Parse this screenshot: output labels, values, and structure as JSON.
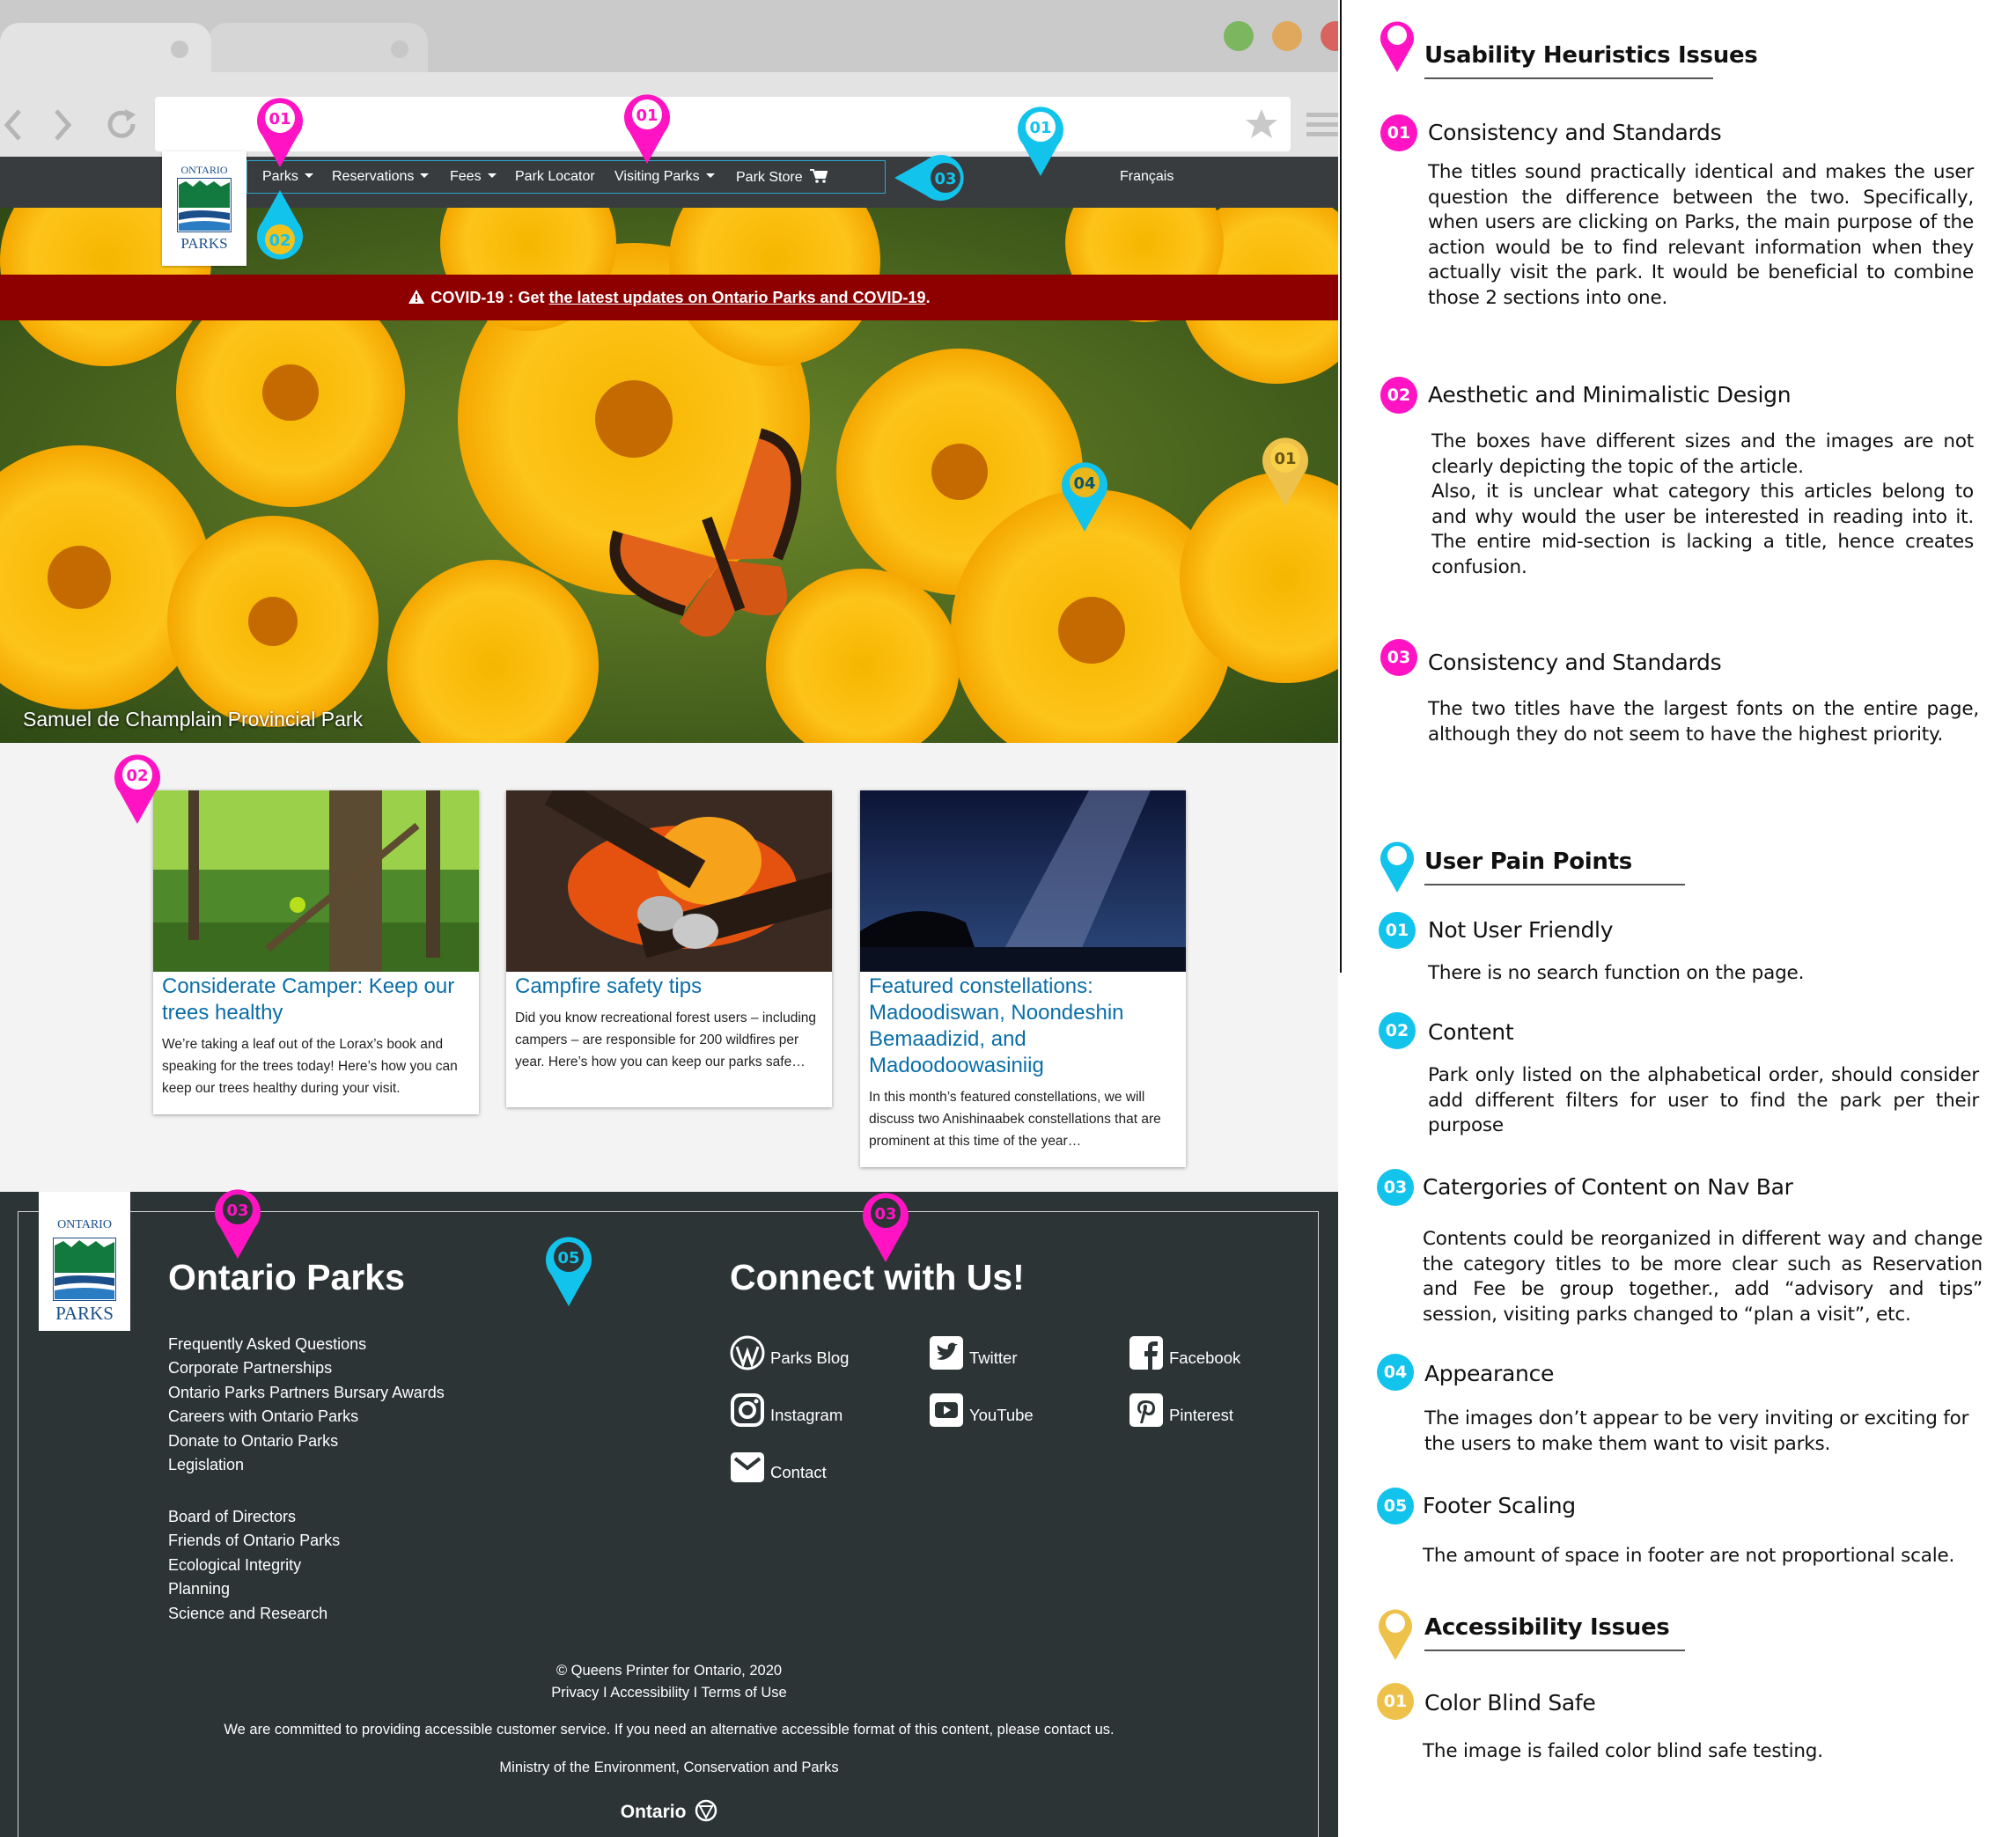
{
  "site": {
    "nav": [
      {
        "label": "Parks",
        "dropdown": true
      },
      {
        "label": "Reservations",
        "dropdown": true
      },
      {
        "label": "Fees",
        "dropdown": true
      },
      {
        "label": "Park Locator",
        "dropdown": false
      },
      {
        "label": "Visiting Parks",
        "dropdown": true
      },
      {
        "label": "Park Store",
        "dropdown": false
      }
    ],
    "language": "Français",
    "logo": {
      "top": "ONTARIO",
      "bottom": "PARKS"
    },
    "alert": {
      "prefix": "COVID-19 : Get ",
      "link": "the latest updates on Ontario Parks and COVID-19",
      "suffix": "."
    },
    "hero_caption": "Samuel de Champlain Provincial Park",
    "cards": [
      {
        "title": "Considerate Camper: Keep our trees healthy",
        "body": "We’re taking a leaf out of the Lorax’s book and speaking for the trees today! Here’s how you can keep our trees healthy during your visit."
      },
      {
        "title": "Campfire safety tips",
        "body": "Did you know recreational forest users – including campers – are responsible for 200 wildfires per year. Here’s how you can keep our parks safe…"
      },
      {
        "title": "Featured constellations: Madoodiswan, Noondeshin Bemaadizid, and Madoodoowasiniig",
        "body": "In this month’s featured constellations, we will discuss two Anishinaabek constellations that are prominent at this time of the year…"
      }
    ],
    "footer": {
      "heading_left": "Ontario Parks",
      "heading_right": "Connect with Us!",
      "links_group1": [
        "Frequently Asked Questions",
        "Corporate Partnerships",
        "Ontario Parks Partners Bursary Awards",
        "Careers with Ontario Parks",
        "Donate to Ontario Parks",
        "Legislation"
      ],
      "links_group2": [
        "Board of Directors",
        "Friends of Ontario Parks",
        "Ecological Integrity",
        "Planning",
        "Science and Research"
      ],
      "social": [
        {
          "label": "Parks Blog",
          "icon": "wordpress-icon"
        },
        {
          "label": "Twitter",
          "icon": "twitter-icon"
        },
        {
          "label": "Facebook",
          "icon": "facebook-icon"
        },
        {
          "label": "Instagram",
          "icon": "instagram-icon"
        },
        {
          "label": "YouTube",
          "icon": "youtube-icon"
        },
        {
          "label": "Pinterest",
          "icon": "pinterest-icon"
        },
        {
          "label": "Contact",
          "icon": "mail-icon"
        }
      ],
      "copyright": "© Queens Printer for Ontario, 2020",
      "legal": "Privacy I Accessibility I Terms of Use",
      "accessibility": "We are committed to providing accessible customer service. If you need an alternative accessible format of this content, please contact us.",
      "ministry": "Ministry of the Environment, Conservation and Parks",
      "ontario": "Ontario"
    }
  },
  "pins": {
    "pin_a": "01",
    "pin_b": "01",
    "pin_c": "01",
    "pin_d": "02",
    "pin_e": "03",
    "pin_f": "04",
    "pin_g": "01",
    "pin_h": "02",
    "pin_i": "03",
    "pin_j": "05",
    "pin_k": "03"
  },
  "colors": {
    "magenta": "#ff13c3",
    "cyan": "#12c3ec",
    "gold": "#edc14a",
    "nav": "#383c3f",
    "footer": "#2c3436",
    "alert": "#8e0000",
    "link": "#0a6ea8"
  },
  "annotations": {
    "heuristics_title": "Usability Heuristics Issues",
    "heuristics": [
      {
        "num": "01",
        "title": "Consistency and Standards",
        "body": "The titles sound practically identical and makes the user question the difference between the two. Specifically, when users are clicking on Parks, the main purpose of the action would be to find relevant information when they actually visit the park. It would be beneficial to combine those 2 sections into one."
      },
      {
        "num": "02",
        "title": "Aesthetic and Minimalistic Design",
        "body1": "The boxes have different sizes and the images are not clearly depicting the topic of the article.",
        "body2": "Also, it is unclear what category this articles belong to and why would the user be interested in reading into it. The entire mid-section is lacking a title, hence creates confusion."
      },
      {
        "num": "03",
        "title": "Consistency and Standards",
        "body": "The two titles have the largest fonts on the entire page, although they do not seem to have the highest priority."
      }
    ],
    "pain_title": "User Pain Points",
    "pain": [
      {
        "num": "01",
        "title": "Not User Friendly",
        "body": "There is no search function on the page."
      },
      {
        "num": "02",
        "title": "Content",
        "body": "Park only listed on the alphabetical order,  should consider add different filters for user to find the park per their purpose"
      },
      {
        "num": "03",
        "title": "Catergories of Content on Nav Bar",
        "body": "Contents could be reorganized in different way and change the category titles to be more clear such as Reservation and Fee be group together., add “advisory and tips” session, visiting parks changed to “plan a visit”, etc."
      },
      {
        "num": "04",
        "title": "Appearance",
        "body": "The images don’t appear to be very inviting or exciting for the users to make them want to visit parks."
      },
      {
        "num": "05",
        "title": "Footer Scaling",
        "body": "The amount of space  in footer are not proportional scale."
      }
    ],
    "access_title": "Accessibility Issues",
    "access": [
      {
        "num": "01",
        "title": "Color Blind Safe",
        "body": "The image is failed color blind safe testing."
      }
    ]
  }
}
